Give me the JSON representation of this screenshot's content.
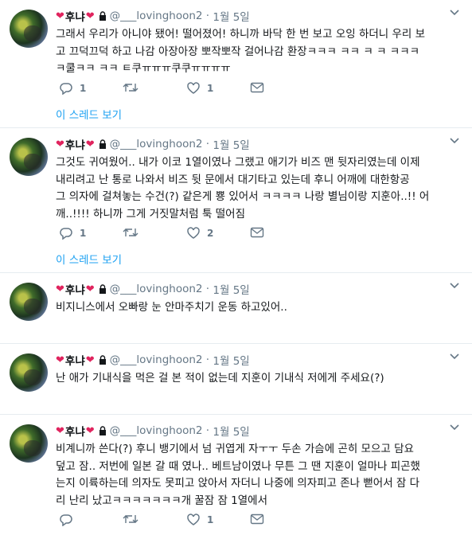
{
  "tweets": [
    {
      "display_name": "후냐",
      "handle": "@___lovinghoon2",
      "date": "1월 5일",
      "lines": [
        "그래서 우리가 아니야 됐어! 떨어졌어! 하니까 바닥 한 번 보고 오잉 하더니 우리 보",
        "고 끄덕끄덕 하고 나감 아장아장 뽀작뽀작 걸어나감 환장ㅋㅋㅋ ㅋㅋ ㅋ ㅋ ㅋㅋㅋ",
        "ㅋ쿨ㅋㅋ ㅋㅋ ㅌ쿠ㅠㅠㅠ쿠쿠ㅠㅠㅠㅠ"
      ],
      "reply_count": "1",
      "retweet_count": "",
      "like_count": "1",
      "thread_label": "이 스레드 보기"
    },
    {
      "display_name": "후냐",
      "handle": "@___lovinghoon2",
      "date": "1월 5일",
      "lines": [
        "그것도 귀여웠어.. 내가 이코 1열이였나 그랬고 애기가 비즈 맨 뒷자리였는데 이제",
        "내리려고 난 통로 나와서 비즈 뒷 문에서 대기타고 있는데 후니 어깨에 대한항공",
        "그 의자에 걸쳐놓는 수건(?) 같은게 뿅 있어서 ㅋㅋㅋㅋ 나랑 별님이랑 지훈아..!! 어",
        "깨..!!!! 하니까 그게 거짓말처럼 툭 떨어짐"
      ],
      "reply_count": "1",
      "retweet_count": "",
      "like_count": "2",
      "thread_label": "이 스레드 보기"
    },
    {
      "display_name": "후냐",
      "handle": "@___lovinghoon2",
      "date": "1월 5일",
      "lines": [
        "비지니스에서 오빠랑 눈 안마주치기 운동 하고있어.."
      ],
      "reply_count": "",
      "retweet_count": "",
      "like_count": "",
      "thread_label": ""
    },
    {
      "display_name": "후냐",
      "handle": "@___lovinghoon2",
      "date": "1월 5일",
      "lines": [
        "난 애가 기내식을 먹은 걸 본 적이 없는데 지훈이 기내식 저에게 주세요(?)"
      ],
      "reply_count": "",
      "retweet_count": "",
      "like_count": "",
      "thread_label": ""
    },
    {
      "display_name": "후냐",
      "handle": "@___lovinghoon2",
      "date": "1월 5일",
      "lines": [
        "비계니까 쓴다(?) 후니 뱅기에서 넘 귀엽게 자ㅜㅜ 두손 가슴에 곤히 모으고 담요",
        "덮고 잠.. 저번에 일본 갈 때 였나.. 베트남이였나 무튼 그 땐 지훈이 얼마나 피곤했",
        "는지 이륙하는데 의자도 못피고 앉아서 자더니 나중에 의자피고 존나 뻗어서 잠 다",
        "리 난리 났고ㅋㅋㅋㅋㅋㅋㅋ개 꿀잠 잠 1열에서"
      ],
      "reply_count": "",
      "retweet_count": "",
      "like_count": "1",
      "thread_label": ""
    }
  ],
  "colors": {
    "heart": "#e0245e",
    "link": "#1da1f2",
    "muted": "#657786",
    "text": "#14171a"
  }
}
